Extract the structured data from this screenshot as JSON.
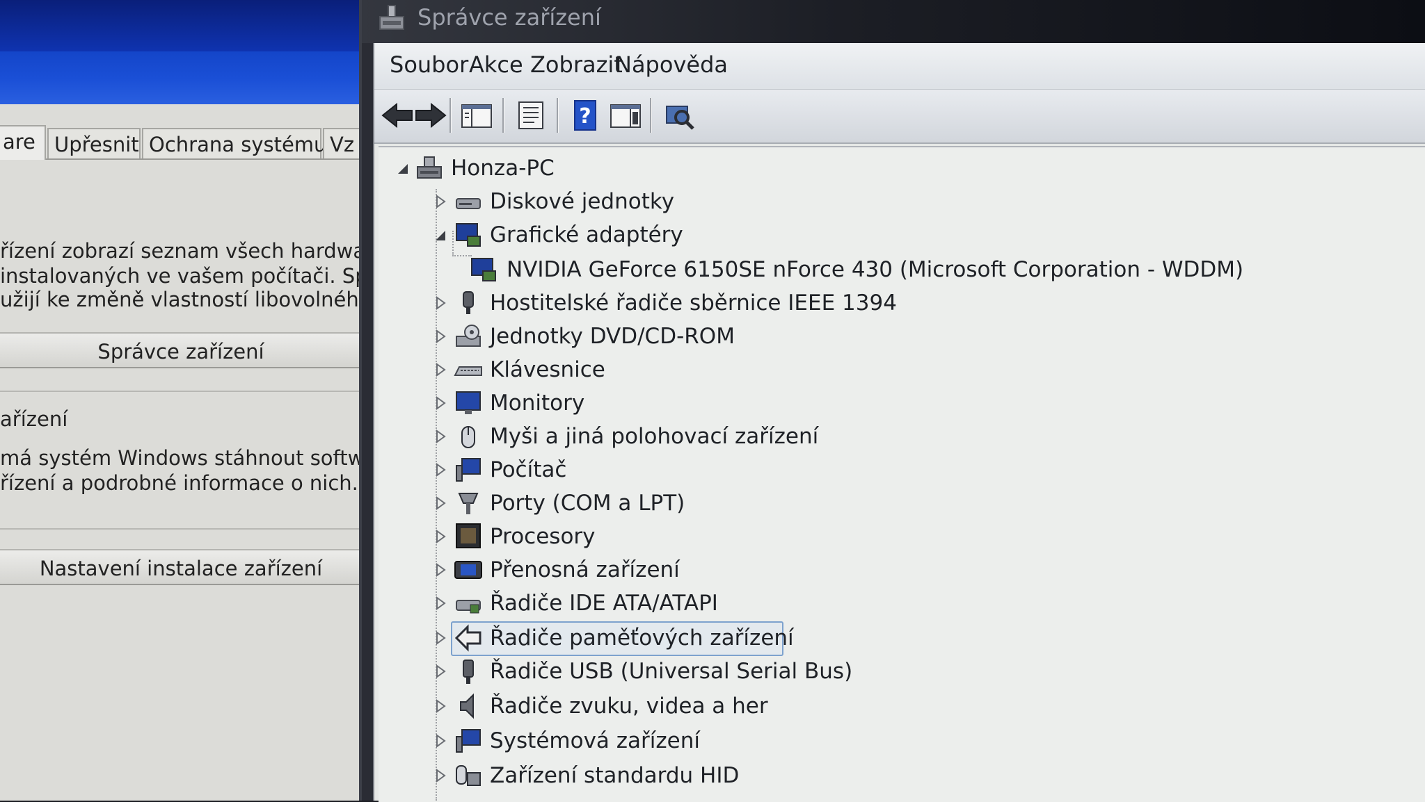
{
  "background_window": {
    "tabs": [
      {
        "label": "are"
      },
      {
        "label": "Upřesnit"
      },
      {
        "label": "Ochrana systému"
      },
      {
        "label": "Vz"
      }
    ],
    "description_lines": [
      "řízení zobrazí seznam všech hardwaro",
      "instalovaných ve vašem počítači. Správ",
      "užĳí ke změně vlastností libovolného za"
    ],
    "device_manager_button": "Správce zařízení",
    "section_heading": "ařízení",
    "install_lines": [
      " má systém Windows stáhnout software",
      "řízení a podrobné informace o nich."
    ],
    "install_settings_button": "Nastavení instalace zařízení"
  },
  "device_manager": {
    "title": "Správce zařízení",
    "menu": {
      "file": "Soubor",
      "action": "Akce",
      "view": "Zobrazit",
      "help": "Nápověda"
    },
    "toolbar_icons": [
      "back-arrow-icon",
      "forward-arrow-icon",
      "show-hide-tree-icon",
      "properties-icon",
      "help-icon",
      "action-pane-icon",
      "scan-hardware-icon"
    ],
    "tree": {
      "root": "Honza-PC",
      "categories": [
        {
          "label": "Diskové jednotky",
          "icon": "disk-drive-icon",
          "expanded": false
        },
        {
          "label": "Grafické adaptéry",
          "icon": "display-adapter-icon",
          "expanded": true,
          "children": [
            {
              "label": "NVIDIA GeForce 6150SE nForce 430 (Microsoft Corporation - WDDM)",
              "icon": "display-adapter-icon"
            }
          ]
        },
        {
          "label": "Hostitelské řadiče sběrnice IEEE 1394",
          "icon": "ieee1394-icon",
          "expanded": false
        },
        {
          "label": "Jednotky DVD/CD-ROM",
          "icon": "dvd-drive-icon",
          "expanded": false
        },
        {
          "label": "Klávesnice",
          "icon": "keyboard-icon",
          "expanded": false
        },
        {
          "label": "Monitory",
          "icon": "monitor-icon",
          "expanded": false
        },
        {
          "label": "Myši a jiná polohovací zařízení",
          "icon": "mouse-icon",
          "expanded": false
        },
        {
          "label": "Počítač",
          "icon": "computer-icon",
          "expanded": false
        },
        {
          "label": "Porty (COM a LPT)",
          "icon": "port-icon",
          "expanded": false
        },
        {
          "label": "Procesory",
          "icon": "processor-icon",
          "expanded": false
        },
        {
          "label": "Přenosná zařízení",
          "icon": "portable-device-icon",
          "expanded": false
        },
        {
          "label": "Řadiče IDE ATA/ATAPI",
          "icon": "ide-controller-icon",
          "expanded": false
        },
        {
          "label": "Řadiče paměťových zařízení",
          "icon": "storage-controller-icon",
          "expanded": false,
          "selected": true
        },
        {
          "label": "Řadiče USB (Universal Serial Bus)",
          "icon": "usb-icon",
          "expanded": false
        },
        {
          "label": "Řadiče zvuku, videa a her",
          "icon": "speaker-icon",
          "expanded": false
        },
        {
          "label": "Systémová zařízení",
          "icon": "system-device-icon",
          "expanded": false
        },
        {
          "label": "Zařízení standardu HID",
          "icon": "hid-icon",
          "expanded": false
        }
      ]
    }
  }
}
